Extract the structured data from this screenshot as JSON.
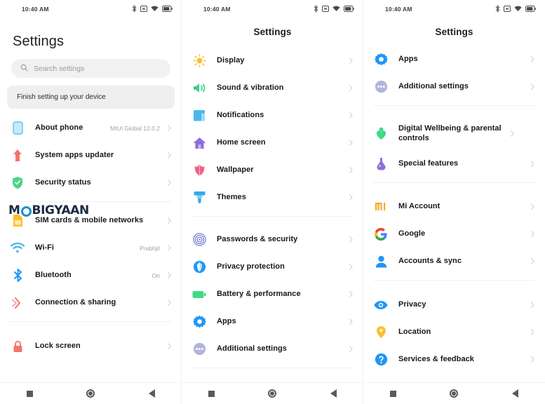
{
  "statusbar": {
    "time": "10:40 AM",
    "icons": [
      "bluetooth-icon",
      "vibrate-icon",
      "wifi-icon",
      "battery-icon"
    ],
    "battery_level": "69"
  },
  "navbar": {
    "recents_label": "recents-button",
    "home_label": "home-button",
    "back_label": "back-button"
  },
  "watermark": {
    "pre": "M",
    "post": "BIGYAAN",
    "color": "#1b2b42",
    "accent": "#1b8fd4"
  },
  "panel1": {
    "title": "Settings",
    "search": {
      "placeholder": "Search settings"
    },
    "banner": {
      "label": "Finish setting up your device"
    },
    "items": [
      {
        "label": "About phone",
        "value": "MIUI Global 12.0.2",
        "icon": "phone-icon",
        "color": "#8fd3f4"
      },
      {
        "label": "System apps updater",
        "value": "",
        "icon": "up-arrow-icon",
        "color": "#f2766b"
      },
      {
        "label": "Security status",
        "value": "",
        "icon": "shield-check-icon",
        "color": "#4cd38a"
      },
      {
        "divider": true
      },
      {
        "label": "SIM cards & mobile networks",
        "value": "",
        "icon": "sim-card-icon",
        "color": "#fbc02d"
      },
      {
        "label": "Wi-Fi",
        "value": "Prabhjit",
        "icon": "wifi-signal-icon",
        "color": "#4ab8ea"
      },
      {
        "label": "Bluetooth",
        "value": "On",
        "icon": "bluetooth-icon",
        "color": "#2196f3"
      },
      {
        "label": "Connection & sharing",
        "value": "",
        "icon": "connection-sharing-icon",
        "color": "#f2766b"
      },
      {
        "divider": true
      },
      {
        "label": "Lock screen",
        "value": "",
        "icon": "lock-icon",
        "color": "#f2766b"
      }
    ]
  },
  "panel2": {
    "title": "Settings",
    "items": [
      {
        "label": "Display",
        "value": "",
        "icon": "brightness-sun-icon",
        "color": "#fbc02d"
      },
      {
        "label": "Sound & vibration",
        "value": "",
        "icon": "speaker-icon",
        "color": "#3ccf8e"
      },
      {
        "label": "Notifications",
        "value": "",
        "icon": "notification-icon",
        "color": "#4ab8ea"
      },
      {
        "label": "Home screen",
        "value": "",
        "icon": "home-icon",
        "color": "#8e6fd8"
      },
      {
        "label": "Wallpaper",
        "value": "",
        "icon": "tulip-icon",
        "color": "#ef5f86"
      },
      {
        "label": "Themes",
        "value": "",
        "icon": "paint-brush-icon",
        "color": "#38a9e8"
      },
      {
        "divider": true
      },
      {
        "label": "Passwords & security",
        "value": "",
        "icon": "fingerprint-icon",
        "color": "#7e7ed6"
      },
      {
        "label": "Privacy protection",
        "value": "",
        "icon": "privacy-shield-icon",
        "color": "#2196f3"
      },
      {
        "label": "Battery & performance",
        "value": "",
        "icon": "battery-icon",
        "color": "#3ddb86"
      },
      {
        "label": "Apps",
        "value": "",
        "icon": "gear-icon",
        "color": "#2196f3"
      },
      {
        "label": "Additional settings",
        "value": "",
        "icon": "more-dots-icon",
        "color": "#9a9ad4"
      }
    ]
  },
  "panel3": {
    "title": "Settings",
    "items": [
      {
        "label": "Apps",
        "value": "",
        "icon": "gear-icon",
        "color": "#2196f3"
      },
      {
        "label": "Additional settings",
        "value": "",
        "icon": "more-dots-icon",
        "color": "#9a9ad4"
      },
      {
        "divider": true
      },
      {
        "label": "Digital Wellbeing & parental controls",
        "value": "",
        "icon": "wellbeing-icon",
        "color": "#3ddb86",
        "tall": true
      },
      {
        "label": "Special features",
        "value": "",
        "icon": "flask-icon",
        "color": "#8e6fd8"
      },
      {
        "divider": true
      },
      {
        "label": "Mi Account",
        "value": "",
        "icon": "mi-logo-icon",
        "color": "#f5a623"
      },
      {
        "label": "Google",
        "value": "",
        "icon": "google-logo-icon",
        "color": "#4285f4"
      },
      {
        "label": "Accounts & sync",
        "value": "",
        "icon": "person-icon",
        "color": "#2196f3"
      },
      {
        "divider": true
      },
      {
        "label": "Privacy",
        "value": "",
        "icon": "eye-icon",
        "color": "#2196f3"
      },
      {
        "label": "Location",
        "value": "",
        "icon": "location-pin-icon",
        "color": "#fbc02d"
      },
      {
        "label": "Services & feedback",
        "value": "",
        "icon": "help-question-icon",
        "color": "#2196f3"
      }
    ]
  }
}
